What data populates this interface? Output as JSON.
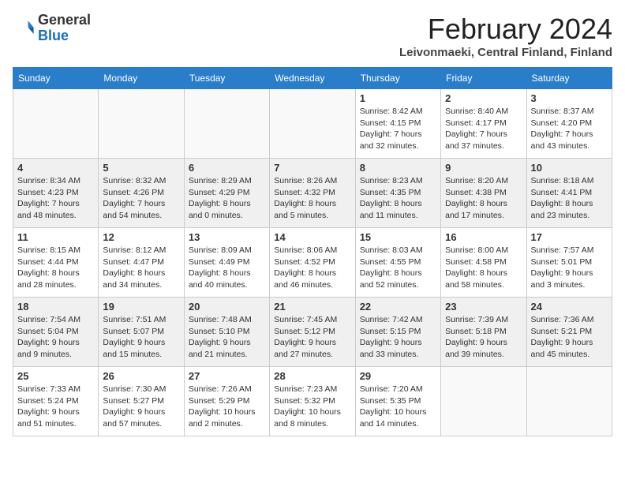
{
  "header": {
    "logo_general": "General",
    "logo_blue": "Blue",
    "month_year": "February 2024",
    "location": "Leivonmaeki, Central Finland, Finland"
  },
  "weekdays": [
    "Sunday",
    "Monday",
    "Tuesday",
    "Wednesday",
    "Thursday",
    "Friday",
    "Saturday"
  ],
  "weeks": [
    [
      {
        "day": "",
        "info": ""
      },
      {
        "day": "",
        "info": ""
      },
      {
        "day": "",
        "info": ""
      },
      {
        "day": "",
        "info": ""
      },
      {
        "day": "1",
        "info": "Sunrise: 8:42 AM\nSunset: 4:15 PM\nDaylight: 7 hours\nand 32 minutes."
      },
      {
        "day": "2",
        "info": "Sunrise: 8:40 AM\nSunset: 4:17 PM\nDaylight: 7 hours\nand 37 minutes."
      },
      {
        "day": "3",
        "info": "Sunrise: 8:37 AM\nSunset: 4:20 PM\nDaylight: 7 hours\nand 43 minutes."
      }
    ],
    [
      {
        "day": "4",
        "info": "Sunrise: 8:34 AM\nSunset: 4:23 PM\nDaylight: 7 hours\nand 48 minutes."
      },
      {
        "day": "5",
        "info": "Sunrise: 8:32 AM\nSunset: 4:26 PM\nDaylight: 7 hours\nand 54 minutes."
      },
      {
        "day": "6",
        "info": "Sunrise: 8:29 AM\nSunset: 4:29 PM\nDaylight: 8 hours\nand 0 minutes."
      },
      {
        "day": "7",
        "info": "Sunrise: 8:26 AM\nSunset: 4:32 PM\nDaylight: 8 hours\nand 5 minutes."
      },
      {
        "day": "8",
        "info": "Sunrise: 8:23 AM\nSunset: 4:35 PM\nDaylight: 8 hours\nand 11 minutes."
      },
      {
        "day": "9",
        "info": "Sunrise: 8:20 AM\nSunset: 4:38 PM\nDaylight: 8 hours\nand 17 minutes."
      },
      {
        "day": "10",
        "info": "Sunrise: 8:18 AM\nSunset: 4:41 PM\nDaylight: 8 hours\nand 23 minutes."
      }
    ],
    [
      {
        "day": "11",
        "info": "Sunrise: 8:15 AM\nSunset: 4:44 PM\nDaylight: 8 hours\nand 28 minutes."
      },
      {
        "day": "12",
        "info": "Sunrise: 8:12 AM\nSunset: 4:47 PM\nDaylight: 8 hours\nand 34 minutes."
      },
      {
        "day": "13",
        "info": "Sunrise: 8:09 AM\nSunset: 4:49 PM\nDaylight: 8 hours\nand 40 minutes."
      },
      {
        "day": "14",
        "info": "Sunrise: 8:06 AM\nSunset: 4:52 PM\nDaylight: 8 hours\nand 46 minutes."
      },
      {
        "day": "15",
        "info": "Sunrise: 8:03 AM\nSunset: 4:55 PM\nDaylight: 8 hours\nand 52 minutes."
      },
      {
        "day": "16",
        "info": "Sunrise: 8:00 AM\nSunset: 4:58 PM\nDaylight: 8 hours\nand 58 minutes."
      },
      {
        "day": "17",
        "info": "Sunrise: 7:57 AM\nSunset: 5:01 PM\nDaylight: 9 hours\nand 3 minutes."
      }
    ],
    [
      {
        "day": "18",
        "info": "Sunrise: 7:54 AM\nSunset: 5:04 PM\nDaylight: 9 hours\nand 9 minutes."
      },
      {
        "day": "19",
        "info": "Sunrise: 7:51 AM\nSunset: 5:07 PM\nDaylight: 9 hours\nand 15 minutes."
      },
      {
        "day": "20",
        "info": "Sunrise: 7:48 AM\nSunset: 5:10 PM\nDaylight: 9 hours\nand 21 minutes."
      },
      {
        "day": "21",
        "info": "Sunrise: 7:45 AM\nSunset: 5:12 PM\nDaylight: 9 hours\nand 27 minutes."
      },
      {
        "day": "22",
        "info": "Sunrise: 7:42 AM\nSunset: 5:15 PM\nDaylight: 9 hours\nand 33 minutes."
      },
      {
        "day": "23",
        "info": "Sunrise: 7:39 AM\nSunset: 5:18 PM\nDaylight: 9 hours\nand 39 minutes."
      },
      {
        "day": "24",
        "info": "Sunrise: 7:36 AM\nSunset: 5:21 PM\nDaylight: 9 hours\nand 45 minutes."
      }
    ],
    [
      {
        "day": "25",
        "info": "Sunrise: 7:33 AM\nSunset: 5:24 PM\nDaylight: 9 hours\nand 51 minutes."
      },
      {
        "day": "26",
        "info": "Sunrise: 7:30 AM\nSunset: 5:27 PM\nDaylight: 9 hours\nand 57 minutes."
      },
      {
        "day": "27",
        "info": "Sunrise: 7:26 AM\nSunset: 5:29 PM\nDaylight: 10 hours\nand 2 minutes."
      },
      {
        "day": "28",
        "info": "Sunrise: 7:23 AM\nSunset: 5:32 PM\nDaylight: 10 hours\nand 8 minutes."
      },
      {
        "day": "29",
        "info": "Sunrise: 7:20 AM\nSunset: 5:35 PM\nDaylight: 10 hours\nand 14 minutes."
      },
      {
        "day": "",
        "info": ""
      },
      {
        "day": "",
        "info": ""
      }
    ]
  ]
}
